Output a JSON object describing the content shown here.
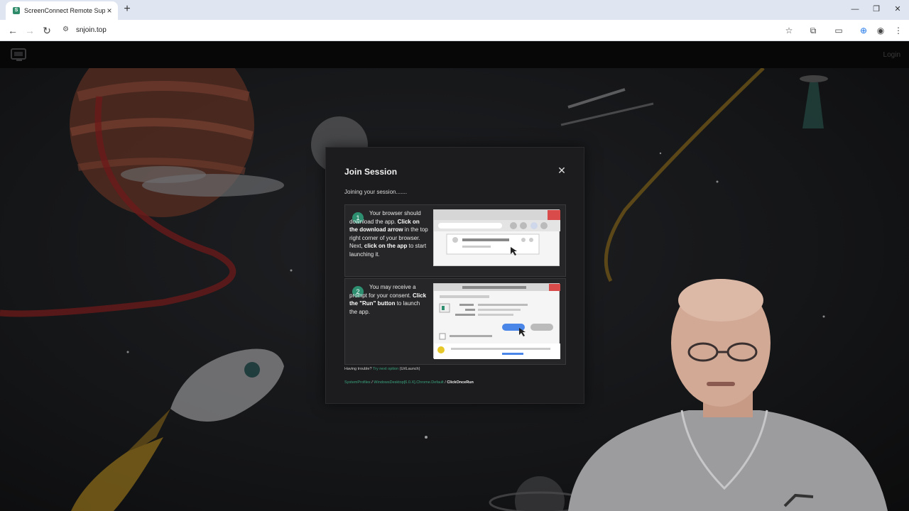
{
  "browser": {
    "tab_title": "ScreenConnect Remote Suppor",
    "url": "snjoin.top",
    "colors": {
      "tabstrip": "#dfe6f2",
      "toolbar": "#ffffff"
    }
  },
  "page": {
    "login_label": "Login"
  },
  "modal": {
    "title": "Join Session",
    "status": "Joining your session.......",
    "step1": {
      "number": "1",
      "text_1": "Your browser should download the app. ",
      "bold_1": "Click on the download arrow",
      "text_2": " in the top right corner of your browser. Next, ",
      "bold_2": "click on the app",
      "text_3": " to start launching it."
    },
    "step2": {
      "number": "2",
      "text_1": "You may receive a prompt for your consent. ",
      "bold_1": "Click the \"Run\" button",
      "text_2": " to launch the app."
    },
    "trouble": {
      "prefix": "Having trouble? ",
      "link": "Try next option",
      "suffix": " (UrlLaunch)"
    },
    "crumbs": {
      "c1": "SystemProfiles",
      "sep1": " / ",
      "c2": "WindowsDesktop[6.0.X].Chrome.Default",
      "sep2": " / ",
      "c3": "ClickOnceRun"
    },
    "accent": "#2d8f70"
  },
  "icons": {
    "back": "back-arrow-icon",
    "forward": "forward-arrow-icon",
    "reload": "reload-icon",
    "bookmark": "star-icon",
    "extensions": "puzzle-icon",
    "download": "download-icon",
    "profile": "profile-icon",
    "menu": "kebab-menu-icon"
  }
}
